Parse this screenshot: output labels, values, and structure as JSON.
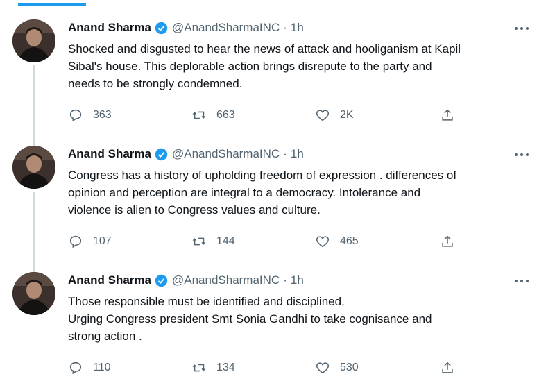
{
  "tweets": [
    {
      "name": "Anand Sharma",
      "handle": "@AnandSharmaINC",
      "time": "1h",
      "lines": [
        "Shocked and disgusted to hear the news of attack and hooliganism at Kapil",
        "Sibal's house. This deplorable action  brings disrepute to the party and",
        "needs to be strongly condemned."
      ],
      "replies": "363",
      "retweets": "663",
      "likes": "2K"
    },
    {
      "name": "Anand Sharma",
      "handle": "@AnandSharmaINC",
      "time": "1h",
      "lines": [
        "Congress has a history of upholding freedom of expression . differences of",
        "opinion and perception are integral to a democracy. Intolerance and",
        "violence is alien to Congress values and culture."
      ],
      "replies": "107",
      "retweets": "144",
      "likes": "465"
    },
    {
      "name": "Anand Sharma",
      "handle": "@AnandSharmaINC",
      "time": "1h",
      "lines": [
        "Those responsible must be identified and disciplined.",
        "Urging Congress president Smt Sonia Gandhi to take cognisance and",
        "strong action ."
      ],
      "replies": "110",
      "retweets": "134",
      "likes": "530"
    }
  ],
  "separator": "·",
  "icons": {
    "verified": "verified-badge-icon",
    "more": "more-options-icon",
    "reply": "reply-icon",
    "retweet": "retweet-icon",
    "like": "like-icon",
    "share": "share-icon"
  },
  "colors": {
    "accent": "#1d9bf0",
    "muted": "#536471",
    "text": "#0f1419",
    "line": "#cfd9de"
  }
}
